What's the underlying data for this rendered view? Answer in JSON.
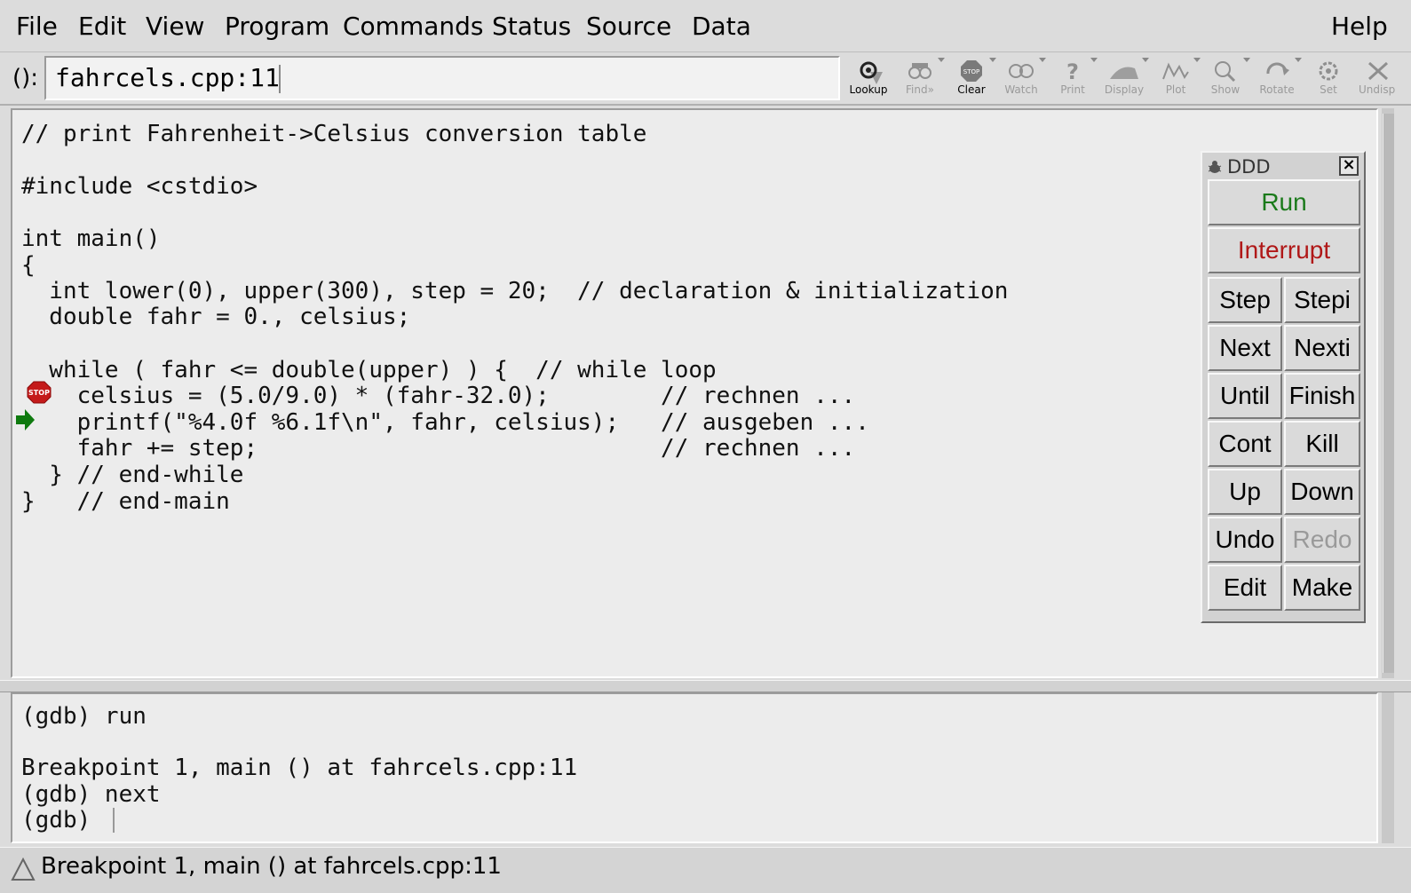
{
  "menubar": {
    "items": [
      "File",
      "Edit",
      "View",
      "Program",
      "Commands",
      "Status",
      "Source",
      "Data"
    ],
    "help": "Help"
  },
  "argument": {
    "label": "():",
    "value": "fahrcels.cpp:11"
  },
  "toolbar": {
    "lookup": "Lookup",
    "find": "Find»",
    "clear": "Clear",
    "watch": "Watch",
    "print": "Print",
    "display": "Display",
    "plot": "Plot",
    "show": "Show",
    "rotate": "Rotate",
    "set": "Set",
    "undisp": "Undisp",
    "stop_glyph": "STOP"
  },
  "source": {
    "lines": [
      "// print Fahrenheit->Celsius conversion table",
      "",
      "#include <cstdio>",
      "",
      "int main()",
      "{",
      "  int lower(0), upper(300), step = 20;  // declaration & initialization",
      "  double fahr = 0., celsius;",
      "",
      "  while ( fahr <= double(upper) ) {  // while loop",
      "    celsius = (5.0/9.0) * (fahr-32.0);        // rechnen ...",
      "    printf(\"%4.0f %6.1f\\n\", fahr, celsius);   // ausgeben ...",
      "    fahr += step;                             // rechnen ...",
      "  } // end-while",
      "}   // end-main"
    ],
    "breakpoint_glyph": "STOP",
    "breakpoint_line": 11,
    "exec_line": 12
  },
  "console": {
    "lines": [
      "(gdb) run",
      "",
      "Breakpoint 1, main () at fahrcels.cpp:11",
      "(gdb) next",
      "(gdb) "
    ]
  },
  "status": {
    "text": "Breakpoint 1, main () at fahrcels.cpp:11"
  },
  "command_tool": {
    "title": "DDD",
    "close": "×",
    "run": "Run",
    "interrupt": "Interrupt",
    "step": "Step",
    "stepi": "Stepi",
    "next": "Next",
    "nexti": "Nexti",
    "until": "Until",
    "finish": "Finish",
    "cont": "Cont",
    "kill": "Kill",
    "up": "Up",
    "down": "Down",
    "undo": "Undo",
    "redo": "Redo",
    "edit": "Edit",
    "make": "Make"
  },
  "colors": {
    "run": "#1a7a1a",
    "interrupt": "#b01818",
    "disabled": "#9a9a9a",
    "breakpoint": "#c41a1a",
    "exec_arrow": "#0f7a0f"
  }
}
